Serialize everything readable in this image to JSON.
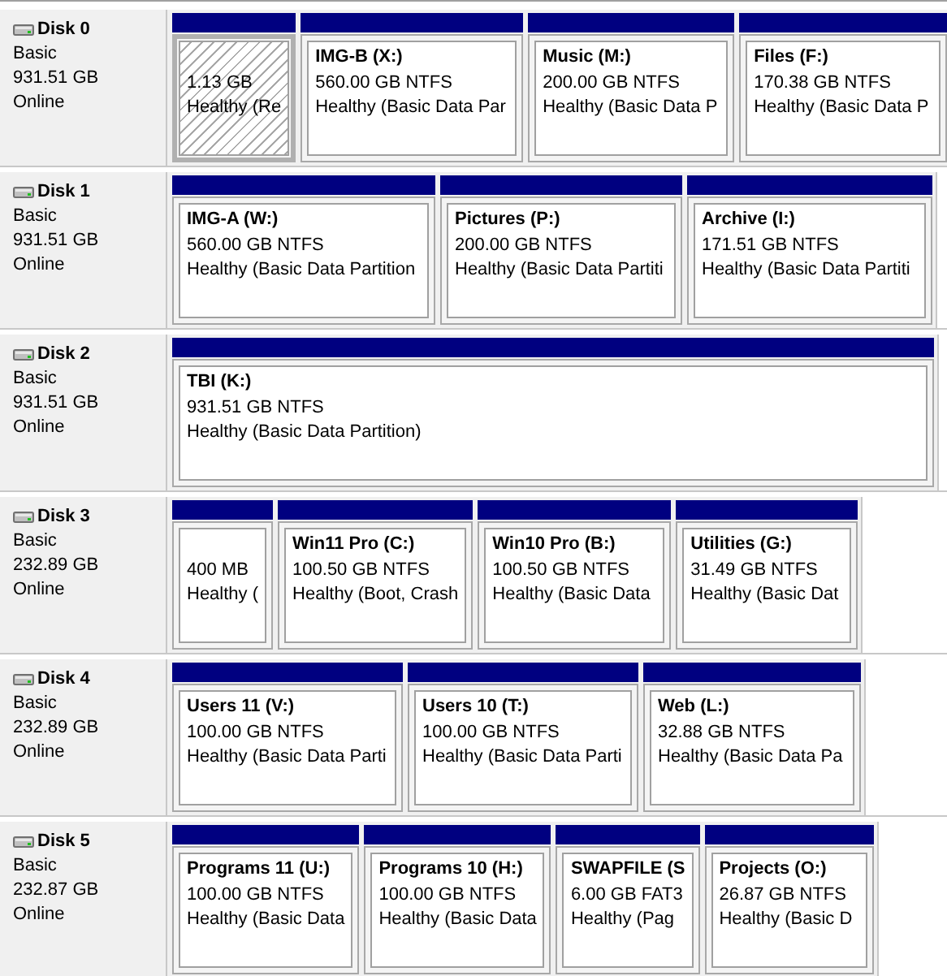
{
  "disks": [
    {
      "name": "Disk 0",
      "type": "Basic",
      "size": "931.51 GB",
      "status": "Online",
      "partitions": [
        {
          "size": "1.13 GB",
          "health": "Healthy (Re",
          "selected": true
        },
        {
          "label": "IMG-B  (X:)",
          "size": "560.00 GB NTFS",
          "health": "Healthy (Basic Data Par",
          "selected": false
        },
        {
          "label": "Music  (M:)",
          "size": "200.00 GB NTFS",
          "health": "Healthy (Basic Data P",
          "selected": false
        },
        {
          "label": "Files  (F:)",
          "size": "170.38 GB NTFS",
          "health": "Healthy (Basic Data P",
          "selected": false
        }
      ]
    },
    {
      "name": "Disk 1",
      "type": "Basic",
      "size": "931.51 GB",
      "status": "Online",
      "partitions": [
        {
          "label": "IMG-A  (W:)",
          "size": "560.00 GB NTFS",
          "health": "Healthy (Basic Data Partition",
          "selected": false
        },
        {
          "label": "Pictures  (P:)",
          "size": "200.00 GB NTFS",
          "health": "Healthy (Basic Data Partiti",
          "selected": false
        },
        {
          "label": "Archive  (I:)",
          "size": "171.51 GB NTFS",
          "health": "Healthy (Basic Data Partiti",
          "selected": false
        }
      ]
    },
    {
      "name": "Disk 2",
      "type": "Basic",
      "size": "931.51 GB",
      "status": "Online",
      "partitions": [
        {
          "label": "TBI  (K:)",
          "size": "931.51 GB NTFS",
          "health": "Healthy (Basic Data Partition)",
          "selected": false
        }
      ]
    },
    {
      "name": "Disk 3",
      "type": "Basic",
      "size": "232.89 GB",
      "status": "Online",
      "partitions": [
        {
          "size": "400 MB",
          "health": "Healthy (",
          "selected": false
        },
        {
          "label": "Win11 Pro  (C:)",
          "size": "100.50 GB NTFS",
          "health": "Healthy (Boot, Crash",
          "selected": false
        },
        {
          "label": "Win10 Pro  (B:)",
          "size": "100.50 GB NTFS",
          "health": "Healthy (Basic Data",
          "selected": false
        },
        {
          "label": "Utilities  (G:)",
          "size": "31.49 GB NTFS",
          "health": "Healthy (Basic Dat",
          "selected": false
        }
      ]
    },
    {
      "name": "Disk 4",
      "type": "Basic",
      "size": "232.89 GB",
      "status": "Online",
      "partitions": [
        {
          "label": "Users 11  (V:)",
          "size": "100.00 GB NTFS",
          "health": "Healthy (Basic Data Parti",
          "selected": false
        },
        {
          "label": "Users 10  (T:)",
          "size": "100.00 GB NTFS",
          "health": "Healthy (Basic Data Parti",
          "selected": false
        },
        {
          "label": "Web  (L:)",
          "size": "32.88 GB NTFS",
          "health": "Healthy (Basic Data Pa",
          "selected": false
        }
      ]
    },
    {
      "name": "Disk 5",
      "type": "Basic",
      "size": "232.87 GB",
      "status": "Online",
      "partitions": [
        {
          "label": "Programs 11  (U:)",
          "size": "100.00 GB NTFS",
          "health": "Healthy (Basic Data",
          "selected": false
        },
        {
          "label": "Programs 10  (H:)",
          "size": "100.00 GB NTFS",
          "health": "Healthy (Basic Data",
          "selected": false
        },
        {
          "label": "SWAPFILE  (S",
          "size": "6.00 GB FAT3",
          "health": "Healthy (Pag",
          "selected": false
        },
        {
          "label": "Projects  (O:)",
          "size": "26.87 GB NTFS",
          "health": "Healthy (Basic D",
          "selected": false
        }
      ]
    }
  ]
}
